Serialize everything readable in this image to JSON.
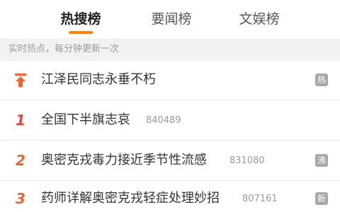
{
  "colors": {
    "accent": "#ff8200",
    "rank_red": "#e8463a",
    "rank_orange": "#f5622b",
    "badge_hot": "#a7a7a7",
    "badge_boil": "#a7a7a7",
    "badge_new": "#a7a7a7"
  },
  "tabs": [
    {
      "label": "热搜榜",
      "active": true
    },
    {
      "label": "要闻榜",
      "active": false
    },
    {
      "label": "文娱榜",
      "active": false
    }
  ],
  "notice": "实时热点，每分钟更新一次",
  "items": [
    {
      "rank_icon": "pin-top-icon",
      "title": "江泽民同志永垂不朽",
      "count": "",
      "badge": "热"
    },
    {
      "rank": "1",
      "title": "全国下半旗志哀",
      "count": "840489",
      "badge": ""
    },
    {
      "rank": "2",
      "title": "奥密克戎毒力接近季节性流感",
      "count": "831080",
      "badge": "沸"
    },
    {
      "rank": "3",
      "title": "药师详解奥密克戎轻症处理妙招",
      "count": "807161",
      "badge": "新"
    }
  ]
}
